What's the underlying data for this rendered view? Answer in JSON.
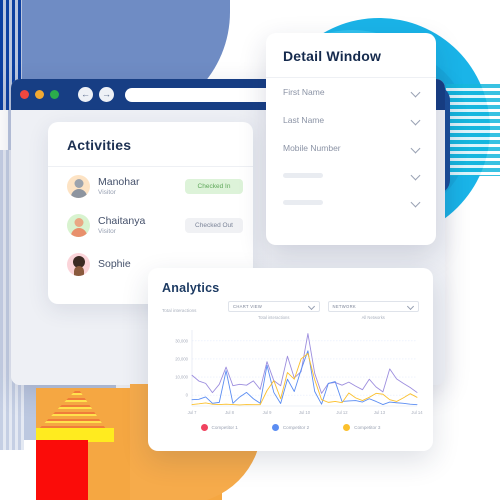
{
  "browser": {
    "traffic_lights": [
      "close-red",
      "minimize-yellow",
      "maximize-green"
    ],
    "back_icon": "←",
    "forward_icon": "→",
    "url_value": "",
    "url_placeholder": ""
  },
  "activities": {
    "title": "Activities",
    "rows": [
      {
        "name": "Manohar",
        "role": "Visitor",
        "status": "Checked In",
        "status_kind": "in",
        "avatar": "avatar-manohar"
      },
      {
        "name": "Chaitanya",
        "role": "Visitor",
        "status": "Checked Out",
        "status_kind": "out",
        "avatar": "avatar-chaitanya"
      },
      {
        "name": "Sophie",
        "role": "",
        "status": "",
        "status_kind": "none",
        "avatar": "avatar-sophie"
      }
    ]
  },
  "detail_window": {
    "title": "Detail Window",
    "fields": [
      {
        "label": "First Name",
        "empty": false
      },
      {
        "label": "Last Name",
        "empty": false
      },
      {
        "label": "Mobile Number",
        "empty": false
      },
      {
        "label": "",
        "empty": true
      },
      {
        "label": "",
        "empty": true
      }
    ]
  },
  "analytics": {
    "title": "Analytics",
    "metric_label": "Total interactions",
    "selects": [
      {
        "name": "chart-view-select",
        "value": "CHART VIEW",
        "caption": "Total interactions"
      },
      {
        "name": "network-select",
        "value": "NETWORK",
        "caption": "All Networks"
      }
    ]
  },
  "colors": {
    "navy": "#173e84",
    "cyan": "#1ab4e8",
    "orange": "#f5a742",
    "red": "#fb0c09",
    "yellow": "#ffeb1f",
    "lavender": "#bcc8e0",
    "periwinkle": "#6f8cc4",
    "series_1": "#f0435f",
    "series_2": "#5b8df2",
    "series_3": "#fbc02d",
    "series_purple": "#9d8ede",
    "badge_in_bg": "#ddf3d9",
    "badge_in_fg": "#5fa85a",
    "badge_out_bg": "#f0f1f4",
    "badge_out_fg": "#7b8498"
  },
  "chart_data": {
    "type": "line",
    "title": "Total interactions",
    "xlabel": "",
    "ylabel": "",
    "ylim": [
      -6000,
      36000
    ],
    "yticks": [
      0,
      10000,
      20000,
      30000
    ],
    "ytick_labels": [
      "0",
      "10,000",
      "20,000",
      "30,000"
    ],
    "grid": true,
    "grid_axis": "y",
    "legend_position": "bottom",
    "x": [
      "Jul 7",
      "Jul 8",
      "Jul 9",
      "Jul 10",
      "Jul 12",
      "Jul 13",
      "Jul 14"
    ],
    "xtick_labels": [
      "Jul 7",
      "Jul 8",
      "Jul 9",
      "Jul 10",
      "Jul 12",
      "Jul 13",
      "Jul 14"
    ],
    "legend": [
      {
        "name": "Competitor 1",
        "color": "#f0435f"
      },
      {
        "name": "Competitor 2",
        "color": "#5b8df2"
      },
      {
        "name": "Competitor 3",
        "color": "#fbc02d"
      }
    ],
    "series": [
      {
        "name": "Competitor 1",
        "color": "#9d8ede",
        "values": [
          11000,
          7800,
          6500,
          1400,
          6000,
          15500,
          5200,
          6000,
          5500,
          7900,
          3200,
          18500,
          8000,
          5200,
          21500,
          9500,
          13000,
          34000,
          12000,
          1000,
          6500,
          7000,
          5500,
          7200,
          5000,
          3000,
          8800,
          4500,
          1800,
          14500,
          9000,
          6500,
          4200,
          1500
        ]
      },
      {
        "name": "Competitor 2",
        "color": "#5b8df2",
        "values": [
          -2500,
          -2300,
          -1000,
          -4500,
          -4000,
          13500,
          -4500,
          -1000,
          1500,
          -2000,
          -4500,
          16500,
          1500,
          -4600,
          8800,
          2000,
          14000,
          24500,
          2000,
          -5000,
          6500,
          7500,
          -3500,
          -3200,
          -3000,
          -3800,
          -2000,
          -3500,
          -5200,
          -3800,
          -4200,
          -4500,
          -5000,
          -5300
        ]
      },
      {
        "name": "Competitor 3",
        "color": "#fbc02d",
        "values": [
          -5200,
          -4800,
          -4300,
          -5000,
          -5200,
          -5000,
          -5200,
          -5400,
          -5200,
          -5300,
          -5300,
          2500,
          8000,
          -2000,
          12500,
          8800,
          20000,
          23000,
          8500,
          -2500,
          -4000,
          -3500,
          -4200,
          1200,
          -1500,
          -3000,
          -1200,
          1000,
          500,
          -2500,
          -3500,
          -1500,
          800,
          -1200
        ]
      }
    ]
  }
}
